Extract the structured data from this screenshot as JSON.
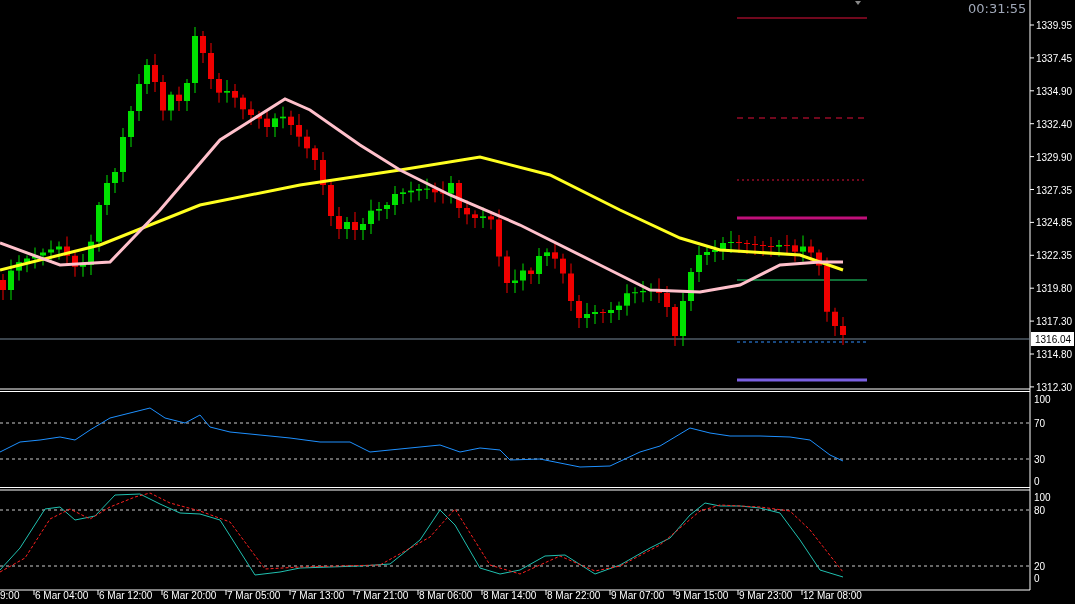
{
  "timer": "00:31:55",
  "price_axis": {
    "labels": [
      "1339.95",
      "1337.45",
      "1334.90",
      "1332.40",
      "1329.90",
      "1327.35",
      "1324.85",
      "1322.35",
      "1319.80",
      "1317.30",
      "1314.80",
      "1312.30"
    ],
    "current": "1316.04"
  },
  "rsi_axis": {
    "labels": [
      "100",
      "70",
      "30",
      "0"
    ]
  },
  "stochastic_axis": {
    "labels": [
      "100",
      "80",
      "20",
      "0"
    ]
  },
  "time_axis": {
    "labels": [
      "9:00",
      "6 Mar 04:00",
      "6 Mar 12:00",
      "6 Mar 20:00",
      "7 Mar 05:00",
      "7 Mar 13:00",
      "7 Mar 21:00",
      "8 Mar 06:00",
      "8 Mar 14:00",
      "8 Mar 22:00",
      "9 Mar 07:00",
      "9 Mar 15:00",
      "9 Mar 23:00",
      "12 Mar 08:00"
    ]
  }
}
